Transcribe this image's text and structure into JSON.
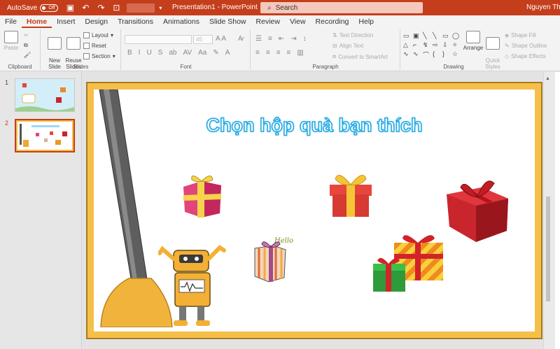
{
  "titlebar": {
    "autosave_label": "AutoSave",
    "autosave_state": "Off",
    "doc_title": "Presentation1  -  PowerPoint",
    "search_placeholder": "Search",
    "user_name": "Nguyen Thi Ng"
  },
  "tabs": [
    "File",
    "Home",
    "Insert",
    "Design",
    "Transitions",
    "Animations",
    "Slide Show",
    "Review",
    "View",
    "Recording",
    "Help"
  ],
  "active_tab": "Home",
  "ribbon": {
    "clipboard": {
      "paste": "Paste",
      "label": "Clipboard"
    },
    "slides": {
      "new_slide": "New\nSlide",
      "reuse_slides": "Reuse\nSlides",
      "layout": "Layout",
      "reset": "Reset",
      "section": "Section",
      "label": "Slides"
    },
    "font": {
      "size": "45",
      "label": "Font"
    },
    "paragraph": {
      "text_direction": "Text Direction",
      "align_text": "Align Text",
      "convert_smartart": "Convert to SmartArt",
      "label": "Paragraph"
    },
    "drawing": {
      "arrange": "Arrange",
      "quick_styles": "Quick\nStyles",
      "shape_fill": "Shape Fill",
      "shape_outline": "Shape Outline",
      "shape_effects": "Shape Effects",
      "label": "Drawing"
    }
  },
  "thumbnails": [
    {
      "number": "1",
      "text": "Chọn hộp quà"
    },
    {
      "number": "2",
      "text": "Chọn hộp quà bạn thích"
    }
  ],
  "slide": {
    "title": "Chọn hộp quà bạn thích",
    "robot_tag": "Hello"
  },
  "colors": {
    "accent": "#c43e1c",
    "slide_border": "#f5c048",
    "title_outline": "#1fa6e0"
  }
}
